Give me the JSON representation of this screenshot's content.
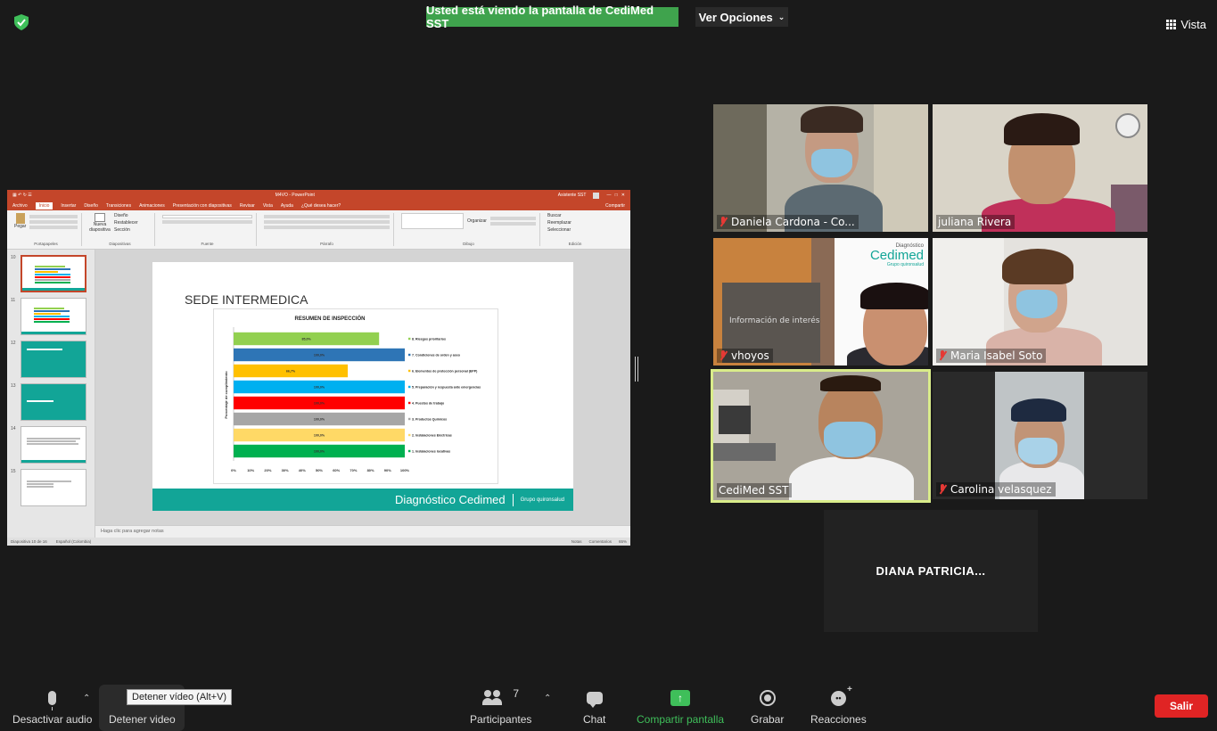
{
  "banner": {
    "sharing_text": "Usted está viendo la pantalla de CediMed SST",
    "view_options": "Ver Opciones",
    "view_label": "Vista"
  },
  "ppt": {
    "title": "M4VO - PowerPoint",
    "user": "Asistente SST",
    "share": "Compartir",
    "tabs": [
      "Archivo",
      "Inicio",
      "Insertar",
      "Diseño",
      "Transiciones",
      "Animaciones",
      "Presentación con diapositivas",
      "Revisar",
      "Vista",
      "Ayuda",
      "¿Qué desea hacer?"
    ],
    "ribbon_groups": [
      "Portapapeles",
      "Diapositivas",
      "Fuente",
      "Párrafo",
      "Dibujo",
      "Edición"
    ],
    "ribbon_buttons": {
      "paste": "Pegar",
      "new_slide": "Nueva diapositiva",
      "layout": "Diseño",
      "reset": "Restablecer",
      "section": "Sección",
      "organize": "Organizar",
      "find": "Buscar",
      "replace": "Reemplazar",
      "select": "Seleccionar"
    },
    "thumbnails": [
      {
        "num": "10",
        "title": "SEDE INTERMEDICA"
      },
      {
        "num": "11",
        "title": "SEDE SABANETA"
      },
      {
        "num": "12",
        "title": "PLAN DE ACCIÓN"
      },
      {
        "num": "13",
        "title": "PROGRAMA DE EPP"
      },
      {
        "num": "14",
        "title": "Capacitación"
      },
      {
        "num": "15",
        "title": "Plan de Trabajo"
      }
    ],
    "slide_title": "SEDE INTERMEDICA",
    "footer_brand": "Diagnóstico Cedimed",
    "footer_group": "Grupo quironsalud",
    "notes_placeholder": "Haga clic para agregar notas",
    "status_left": "Diapositiva 10 de 16",
    "status_lang": "Español (Colombia)",
    "status_notes": "Notas",
    "status_comments": "Comentarios",
    "zoom": "65%"
  },
  "chart_data": {
    "type": "bar",
    "title": "RESUMEN DE INSPECCIÓN",
    "ylabel": "Porcentaje de cumplimiento",
    "xlim": [
      0,
      100
    ],
    "x_ticks": [
      "0%",
      "10%",
      "20%",
      "30%",
      "40%",
      "50%",
      "60%",
      "70%",
      "80%",
      "90%",
      "100%"
    ],
    "categories": [
      "8. Riesgos prioritarios",
      "7. Condiciones de orden y aseo",
      "6. Elementos de protección personal (EPP)",
      "5. Preparación y respuesta ante emergencias",
      "4. Puestos de trabajo",
      "3. Productos Químicos",
      "2. Instalaciones Eléctricas",
      "1. Instalaciones locativas"
    ],
    "values": [
      85.0,
      100.0,
      66.7,
      100.0,
      100.0,
      100.0,
      100.0,
      100.0
    ],
    "value_labels": [
      "85,0%",
      "100,0%",
      "66,7%",
      "100,0%",
      "100,0%",
      "100,0%",
      "100,0%",
      "100,0%"
    ],
    "colors": [
      "#92d050",
      "#2e75b6",
      "#ffc000",
      "#00b0f0",
      "#ff0000",
      "#a6a6a6",
      "#ffd966",
      "#00b050"
    ]
  },
  "participants": [
    {
      "name": "Daniela Cardona - Co...",
      "muted": true
    },
    {
      "name": "juliana Rivera",
      "muted": false
    },
    {
      "name": "vhoyos",
      "muted": true
    },
    {
      "name": "Maria Isabel Soto",
      "muted": true
    },
    {
      "name": "CediMed SST",
      "muted": false
    },
    {
      "name": "Carolina velasquez",
      "muted": true
    },
    {
      "name": "DIANA  PATRICIA..."
    }
  ],
  "tile_logo": {
    "small": "Diagnóstico",
    "big": "Cedimed",
    "group": "Grupo quironsalud",
    "sign": "Información de interés"
  },
  "toolbar": {
    "mute_audio": "Desactivar audio",
    "stop_video": "Detener video",
    "tooltip": "Detener vídeo (Alt+V)",
    "participants": "Participantes",
    "participants_count": "7",
    "chat": "Chat",
    "share_screen": "Compartir pantalla",
    "record": "Grabar",
    "reactions": "Reacciones",
    "leave": "Salir"
  },
  "colors": {
    "banner_green": "#3fa34d",
    "ppt_red": "#c4462a",
    "teal": "#12a597",
    "active_border": "#d9ec8a",
    "leave_red": "#e02424"
  }
}
